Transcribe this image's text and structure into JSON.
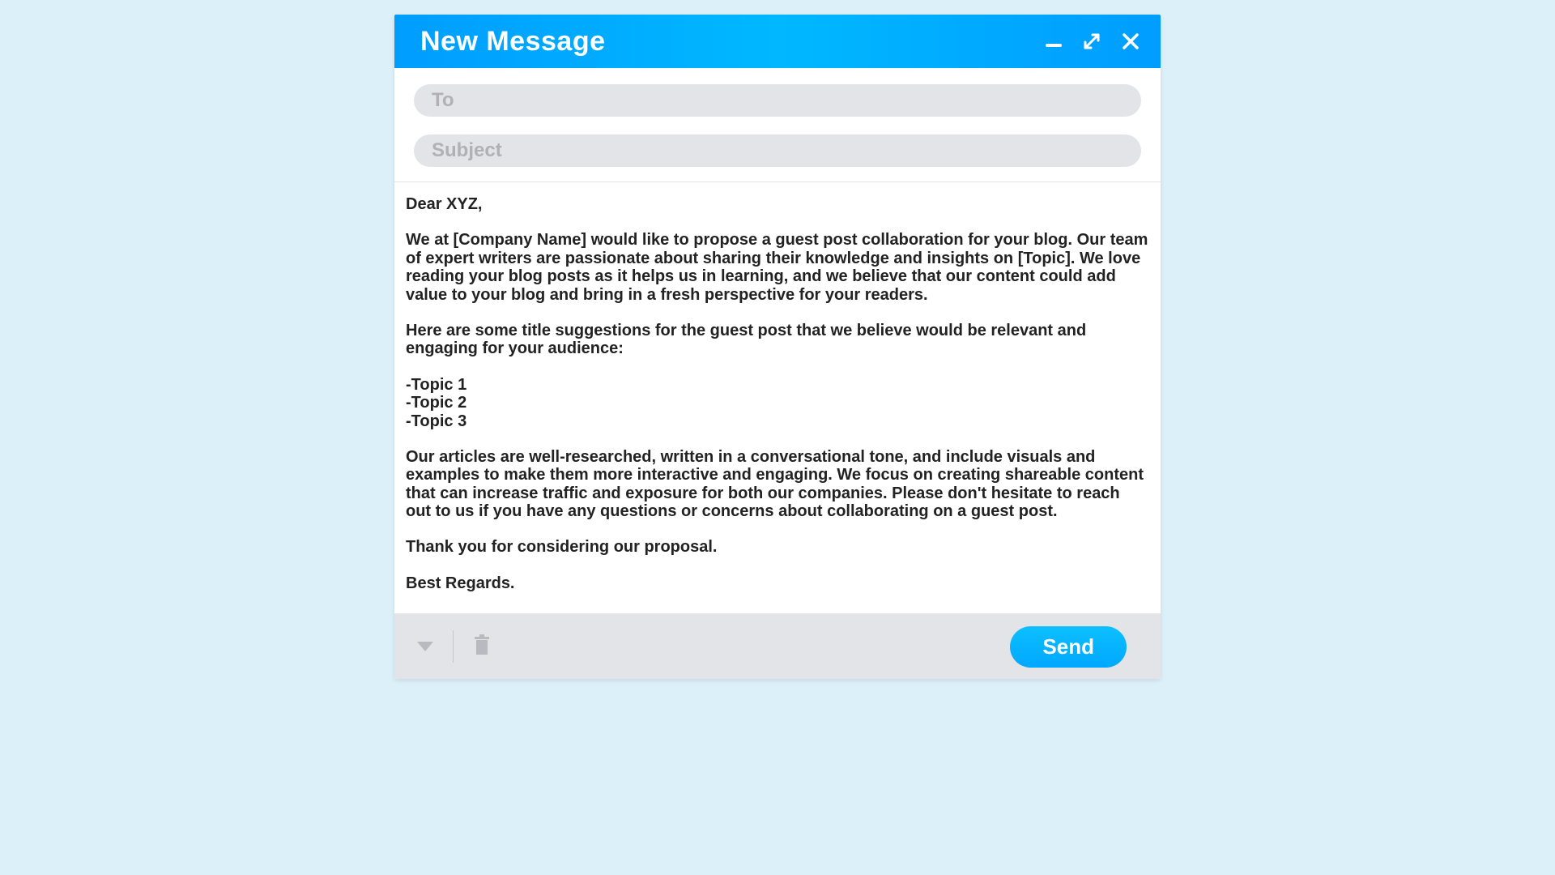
{
  "header": {
    "title": "New Message"
  },
  "fields": {
    "to_placeholder": "To",
    "to_value": "",
    "subject_placeholder": "Subject",
    "subject_value": ""
  },
  "body": {
    "greeting": "Dear XYZ,",
    "p1": "We at [Company Name] would like to propose a guest post collaboration for your blog. Our team of expert writers are passionate about sharing their knowledge and insights on [Topic]. We love reading your blog posts as it helps us in learning, and we believe that our content could add value to your blog and bring in a fresh perspective for your readers.",
    "p2": "Here are some title suggestions for the guest post that we believe would be relevant and engaging for your audience:",
    "topics": "-Topic 1\n-Topic 2\n-Topic 3",
    "p3": "Our articles are well-researched, written in a conversational tone, and include visuals and examples to make them more interactive and engaging. We focus on creating shareable content that can increase traffic and exposure for both our companies. Please don't hesitate to reach out to us if you have any questions or concerns about collaborating on a guest post.",
    "thanks": "Thank you for considering our proposal.",
    "closing": "Best Regards."
  },
  "footer": {
    "send_label": "Send"
  },
  "icons": {
    "minimize": "minimize-icon",
    "expand": "expand-icon",
    "close": "close-icon",
    "dropdown": "dropdown-icon",
    "trash": "trash-icon"
  }
}
